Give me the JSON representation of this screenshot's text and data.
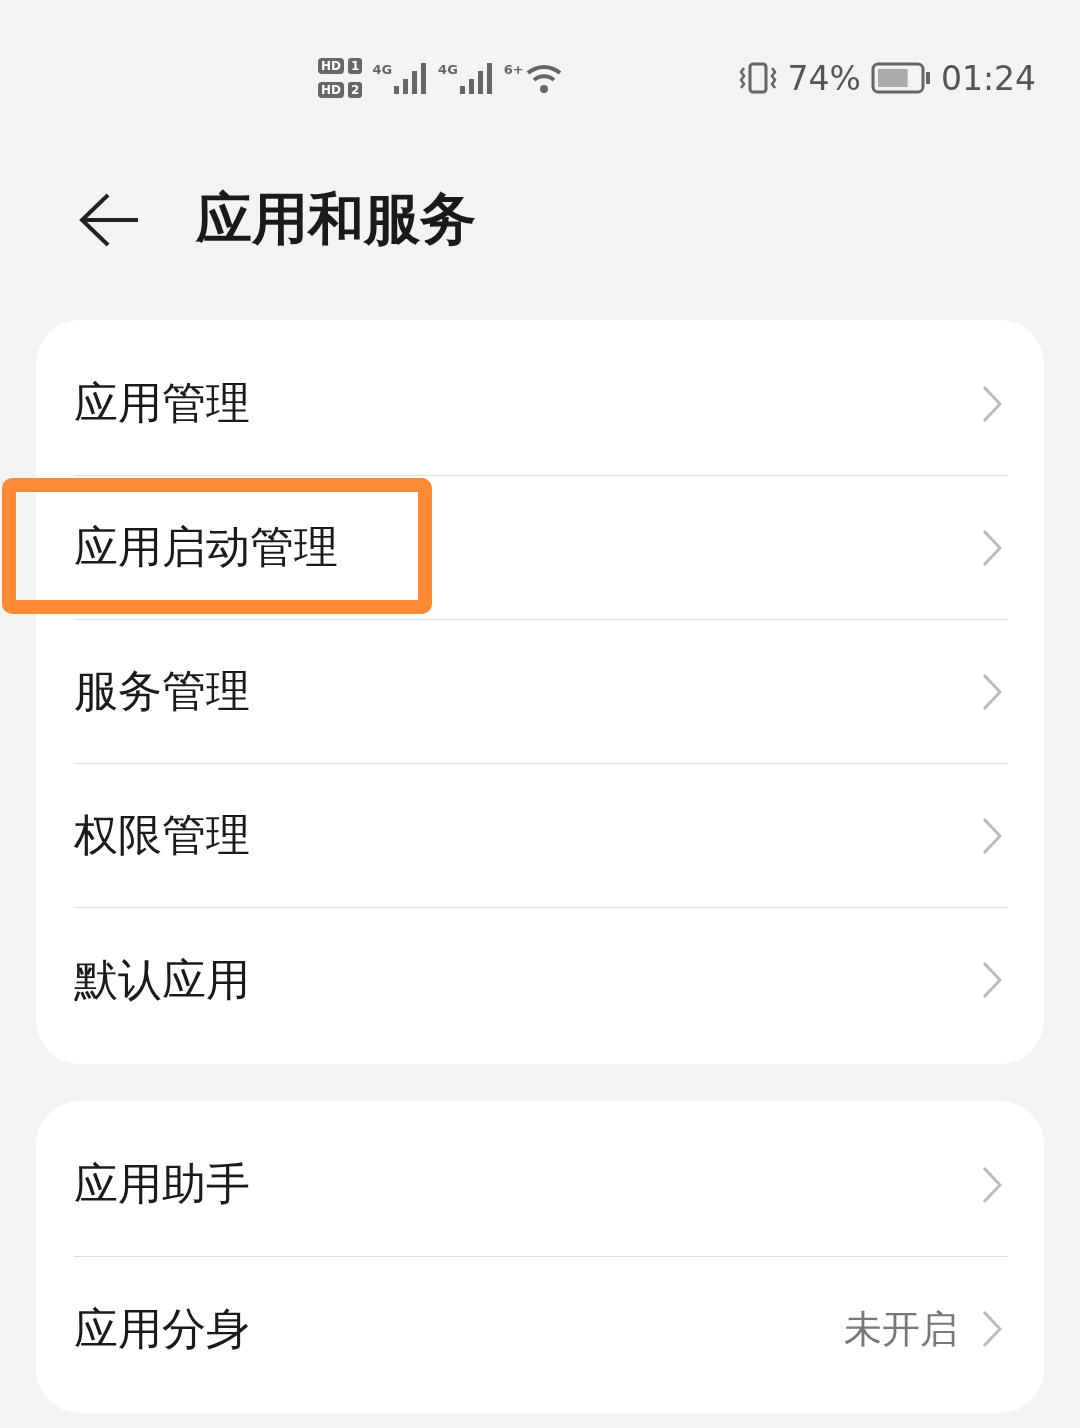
{
  "status_bar": {
    "sims": [
      {
        "badge": "HD",
        "slot": "1"
      },
      {
        "badge": "HD",
        "slot": "2"
      }
    ],
    "networks": [
      {
        "label": "4G"
      },
      {
        "label": "4G"
      }
    ],
    "wifi": "6+",
    "battery": {
      "text": "74%",
      "level": 0.74
    },
    "time": "01:24"
  },
  "header": {
    "title": "应用和服务"
  },
  "groups": [
    {
      "items": [
        {
          "label": "应用管理",
          "highlighted": false
        },
        {
          "label": "应用启动管理",
          "highlighted": true
        },
        {
          "label": "服务管理",
          "highlighted": false
        },
        {
          "label": "权限管理",
          "highlighted": false
        },
        {
          "label": "默认应用",
          "highlighted": false
        }
      ]
    },
    {
      "items": [
        {
          "label": "应用助手",
          "highlighted": false
        },
        {
          "label": "应用分身",
          "value": "未开启",
          "highlighted": false
        }
      ]
    }
  ]
}
